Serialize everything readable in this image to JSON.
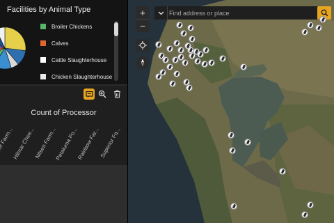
{
  "panel": {
    "title": "Facilities by Animal Type",
    "legend": [
      {
        "label": "Broiler Chickens",
        "color": "#57b46a"
      },
      {
        "label": "Calves",
        "color": "#e2642f"
      },
      {
        "label": "Cattle Slaughterhouse",
        "color": "#ffffff"
      },
      {
        "label": "Chicken Slaughterhouse",
        "color": "#e8e8e8"
      }
    ],
    "pie_colors": [
      "#e6d04a",
      "#2f6fb0",
      "#d9d9d9",
      "#3a8fd0",
      "#57b46a",
      "#e2642f",
      "#8a4fa8",
      "#1f4e8c",
      "#f0f0f0"
    ],
    "toolbar": {
      "filter_icon": "filter-icon",
      "zoom_icon": "zoom-to-icon",
      "trash_icon": "trash-icon"
    },
    "bar_chart": {
      "title": "Count of Processor",
      "categories": [
        "Foster Farm...",
        "Hilmar Chee...",
        "Nilsen Farm...",
        "Petaluma Po...",
        "Rainbow Far...",
        "Superior Fa..."
      ]
    }
  },
  "map": {
    "zoom_in": "+",
    "zoom_out": "−",
    "search": {
      "placeholder": "Find address or place",
      "value": ""
    },
    "accent": "#e7a522"
  }
}
